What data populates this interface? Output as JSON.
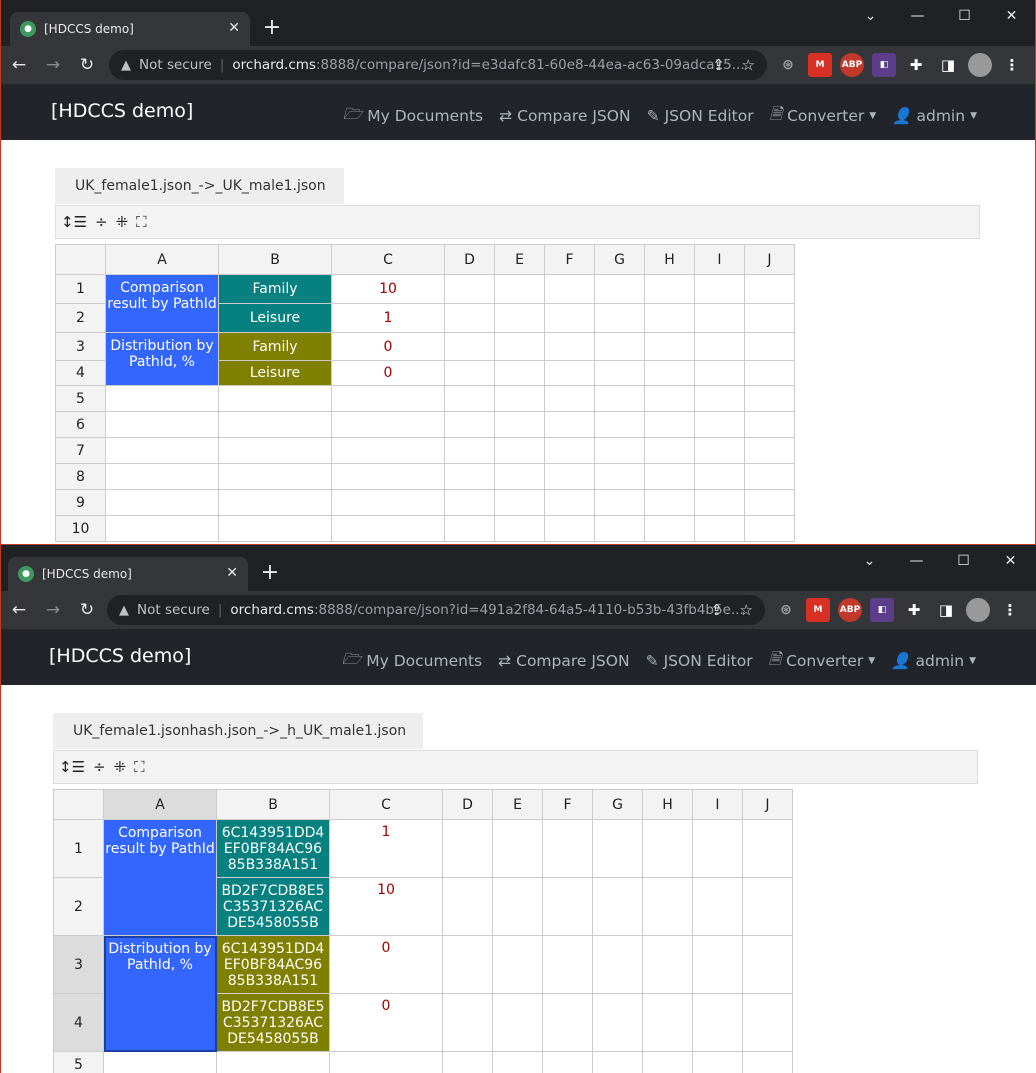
{
  "windows": [
    {
      "tab_title": "[HDCCS demo]",
      "url_security": "Not secure",
      "url_host": "orchard.cms",
      "url_path": ":8888/compare/json?id=e3dafc81-60e8-44ea-ac63-09adca15...",
      "brand": "[HDCCS demo]",
      "nav": {
        "docs": "My Documents",
        "compare": "Compare JSON",
        "editor": "JSON Editor",
        "converter": "Converter",
        "user": "admin"
      },
      "sheet_tab": "UK_female1.json_->_UK_male1.json",
      "columns": [
        "A",
        "B",
        "C",
        "D",
        "E",
        "F",
        "G",
        "H",
        "I",
        "J"
      ],
      "row_numbers": [
        "1",
        "2",
        "3",
        "4",
        "5",
        "6",
        "7",
        "8",
        "9",
        "10"
      ],
      "cells": {
        "a_comp": "Comparison result by PathId",
        "a_dist": "Distribution by PathId, %",
        "b1": "Family",
        "b2": "Leisure",
        "b3": "Family",
        "b4": "Leisure",
        "c1": "10",
        "c2": "1",
        "c3": "0",
        "c4": "0"
      }
    },
    {
      "tab_title": "[HDCCS demo]",
      "url_security": "Not secure",
      "url_host": "orchard.cms",
      "url_path": ":8888/compare/json?id=491a2f84-64a5-4110-b53b-43fb4b5e...",
      "brand": "[HDCCS demo]",
      "nav": {
        "docs": "My Documents",
        "compare": "Compare JSON",
        "editor": "JSON Editor",
        "converter": "Converter",
        "user": "admin"
      },
      "sheet_tab": "UK_female1.jsonhash.json_->_h_UK_male1.json",
      "columns": [
        "A",
        "B",
        "C",
        "D",
        "E",
        "F",
        "G",
        "H",
        "I",
        "J"
      ],
      "row_numbers": [
        "1",
        "2",
        "3",
        "4",
        "5"
      ],
      "cells": {
        "a_comp": "Comparison result by PathId",
        "a_dist": "Distribution by PathId, %",
        "b1": "6C143951DD4EF0BF84AC9685B338A151",
        "b2": "BD2F7CDB8E5C35371326ACDE5458055B",
        "b3": "6C143951DD4EF0BF84AC9685B338A151",
        "b4": "BD2F7CDB8E5C35371326ACDE5458055B",
        "c1": "1",
        "c2": "10",
        "c3": "0",
        "c4": "0"
      }
    }
  ],
  "colors": {
    "blue": "#3366ff",
    "teal": "#078080",
    "olive": "#808000",
    "value_red": "#a10000"
  },
  "icons": [
    "tab-favicon",
    "close-icon",
    "plus-icon",
    "chevron-down-icon",
    "minimize-icon",
    "maximize-icon",
    "back-icon",
    "forward-icon",
    "reload-icon",
    "warning-icon",
    "share-icon",
    "star-icon",
    "extensions-icon",
    "sidebar-icon",
    "avatar",
    "more-icon",
    "folder-icon",
    "compare-icon",
    "edit-icon",
    "file-icon",
    "user-icon",
    "line-height-icon",
    "expand-rows-icon",
    "collapse-icon",
    "fullscreen-icon"
  ]
}
